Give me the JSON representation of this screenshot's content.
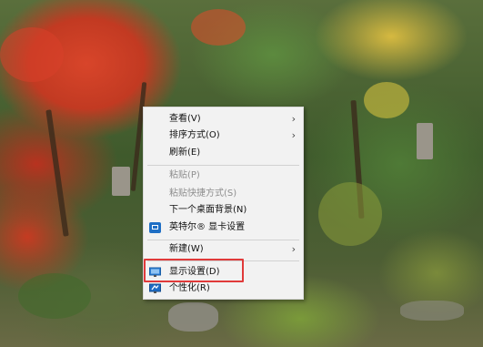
{
  "context_menu": {
    "items": [
      {
        "label": "查看(V)",
        "submenu": true
      },
      {
        "label": "排序方式(O)",
        "submenu": true
      },
      {
        "label": "刷新(E)"
      },
      {
        "label": "粘贴(P)",
        "disabled": true
      },
      {
        "label": "粘贴快捷方式(S)",
        "disabled": true
      },
      {
        "label": "下一个桌面背景(N)"
      },
      {
        "label": "英特尔® 显卡设置",
        "icon": "intel-graphics-icon"
      },
      {
        "label": "新建(W)",
        "submenu": true
      },
      {
        "label": "显示设置(D)",
        "icon": "display-settings-icon",
        "highlighted": true
      },
      {
        "label": "个性化(R)",
        "icon": "personalize-icon"
      }
    ]
  },
  "colors": {
    "menu_background": "#f2f2f2",
    "highlight_border": "#e03a3a",
    "disabled_text": "#8e8e8e"
  }
}
